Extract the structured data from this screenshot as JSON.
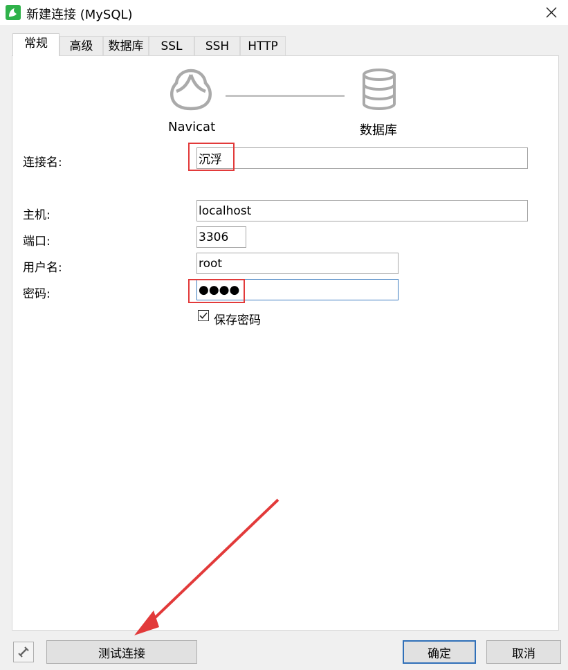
{
  "window": {
    "title": "新建连接 (MySQL)"
  },
  "tabs": [
    {
      "label": "常规",
      "active": true
    },
    {
      "label": "高级"
    },
    {
      "label": "数据库"
    },
    {
      "label": "SSL"
    },
    {
      "label": "SSH"
    },
    {
      "label": "HTTP"
    }
  ],
  "diagram": {
    "left_label": "Navicat",
    "right_label": "数据库"
  },
  "form": {
    "connection_name": {
      "label": "连接名:",
      "value": "沉浮"
    },
    "host": {
      "label": "主机:",
      "value": "localhost"
    },
    "port": {
      "label": "端口:",
      "value": "3306"
    },
    "username": {
      "label": "用户名:",
      "value": "root"
    },
    "password": {
      "label": "密码:",
      "value": "●●●●"
    },
    "save_password": {
      "label": "保存密码",
      "checked": true
    }
  },
  "buttons": {
    "test": "测试连接",
    "ok": "确定",
    "cancel": "取消"
  },
  "colors": {
    "highlight": "#e23a3a",
    "app_icon": "#2fb24a",
    "primary_border": "#2f6fb8"
  }
}
